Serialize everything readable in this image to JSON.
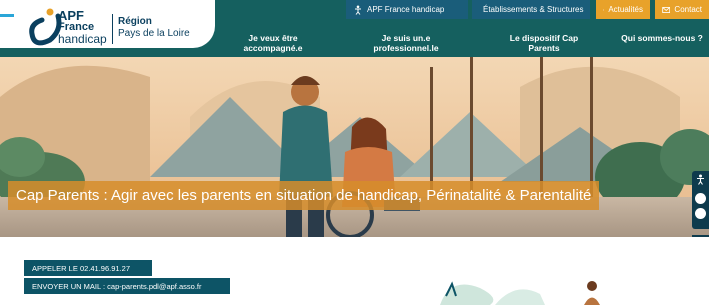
{
  "logo": {
    "apf": "APF",
    "france": "France",
    "handicap": "handicap",
    "region_line1": "Région",
    "region_line2": "Pays de la Loire"
  },
  "utility_nav": [
    {
      "label": "APF France handicap",
      "icon": "accessibility-icon"
    },
    {
      "label": "Établissements & Structures",
      "icon": "map-pin-icon"
    },
    {
      "label": "Actualités",
      "icon": "newspaper-icon"
    },
    {
      "label": "Contact",
      "icon": "mail-icon"
    }
  ],
  "main_nav": [
    {
      "label": "Je veux être accompagné.e"
    },
    {
      "label": "Je suis un.e professionnel.le"
    },
    {
      "label": "Le dispositif Cap Parents"
    },
    {
      "label": "Qui sommes-nous ?"
    }
  ],
  "hero": {
    "title": "Cap Parents : Agir avec les parents en situation de handicap, Périnatalité & Parentalité"
  },
  "contact": {
    "call_label": "APPELER LE 02.41.96.91.27",
    "email_label": "ENVOYER UN MAIL : cap-parents.pdl@apf.asso.fr"
  },
  "colors": {
    "header": "#15605f",
    "accent_orange": "#e8a22a",
    "button_dark": "#0d5466",
    "logo_navy": "#0a3f5e"
  }
}
